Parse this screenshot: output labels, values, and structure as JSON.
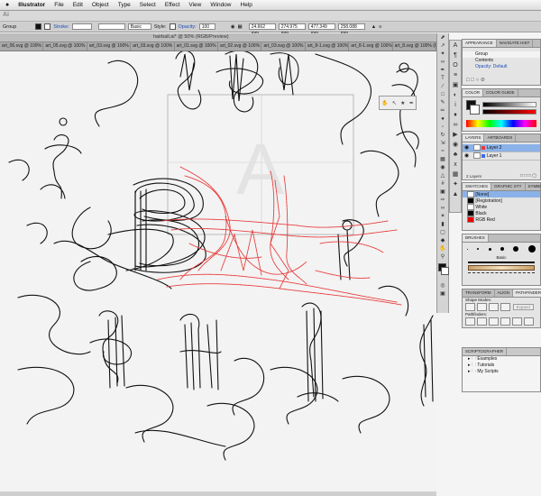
{
  "menubar": {
    "apple": "",
    "app": "Illustrator",
    "items": [
      "File",
      "Edit",
      "Object",
      "Type",
      "Select",
      "Effect",
      "View",
      "Window",
      "Help"
    ]
  },
  "appbar": {
    "logo": "Ai"
  },
  "controlbar": {
    "selection": "Group",
    "stroke_label": "Stroke:",
    "brush": "Basic",
    "style_label": "Style:",
    "opacity_label": "Opacity:",
    "opacity_value": "100",
    "x_value": "24.662 mm",
    "y_value": "274.975 mm",
    "w_value": "477.349 mm",
    "h_value": "258.088 mm"
  },
  "document": {
    "title": "hairball.ai* @ 50% (RGB/Preview)",
    "tabs": [
      "art_06.svg @ 100% (RGB/Pre...",
      "art_05.svg @ 100% (RGB/Pre...",
      "art_03.svg @ 100% (RGB/Pre...",
      "art_03.svg @ 100% (RGB/Pre...",
      "art_01.svg @ 100% (RGB/Pre...",
      "art_02.svg @ 100% (RGB/Pre...",
      "art_03.svg @ 100% (RGB/Pre...",
      "art_8-1.svg @ 100% (RGB/Pre...",
      "art_8-1.svg @ 100% (RGB/Pre...",
      "art_8.svg @ 100% (RGB/Pre..."
    ]
  },
  "canvas": {
    "artboard_glyph": "A",
    "stroke_black": "#111111",
    "stroke_red": "#e83a3a"
  },
  "panels": {
    "appearance": {
      "tabs": [
        "APPEARANCE",
        "NAVIGATE HIST"
      ],
      "rows": [
        "Group",
        "Contents",
        "Opacity: Default"
      ]
    },
    "color": {
      "tabs": [
        "COLOR",
        "COLOR GUIDE"
      ]
    },
    "layers": {
      "tabs": [
        "LAYERS",
        "ARTBOARDS"
      ],
      "items": [
        "Layer 2",
        "Layer 1"
      ],
      "footer": "2 Layers"
    },
    "swatches": {
      "tabs": [
        "SWATCHES",
        "GRAPHIC STY",
        "SYMBOLS"
      ],
      "items": [
        "[None]",
        "[Registration]",
        "White",
        "Black",
        "RGB Red"
      ]
    },
    "brushes": {
      "tabs": [
        "BRUSHES"
      ],
      "label": "Basic"
    },
    "pathfinder": {
      "tabs": [
        "TRANSFORM",
        "ALIGN",
        "PATHFINDER"
      ],
      "shape_modes": "Shape Modes:",
      "expand": "Expand",
      "pathfinders": "Pathfinders:"
    },
    "scriptographer": {
      "title": "SCRIPTOGRAPHER",
      "items": [
        "Examples",
        "Tutorials",
        "My Scripts"
      ]
    }
  }
}
